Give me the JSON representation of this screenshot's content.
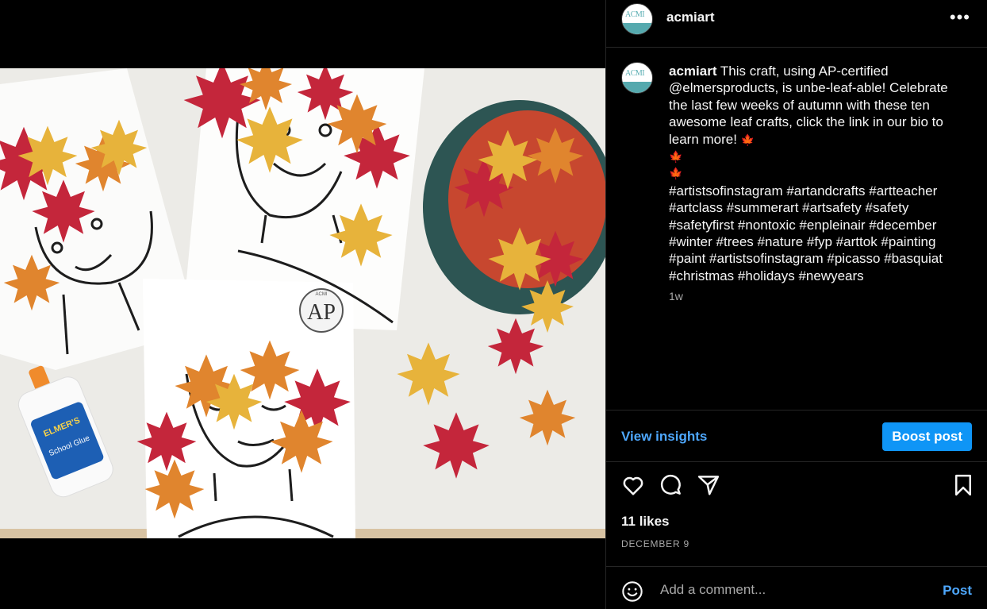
{
  "post": {
    "username": "acmiart",
    "avatar_text": "ACMI"
  },
  "caption": {
    "username": "acmiart",
    "lines": [
      "This craft, using AP-certified",
      "@elmersproducts, is unbe-leaf-able! Celebrate",
      "the last few weeks of autumn with these ten",
      "awesome leaf crafts, click the link in our bio to",
      "learn more!"
    ],
    "hashtag_lines": [
      "#artistsofinstagram #artandcrafts #artteacher",
      "#artclass #summerart #artsafety #safety",
      "#safetyfirst #nontoxic #enpleinair #december",
      "#winter #trees #nature #fyp #arttok #painting",
      "#paint #artistsofinstagram #picasso #basquiat",
      "#christmas #holidays #newyears"
    ],
    "emoji": "🍁",
    "time_ago": "1w"
  },
  "photo": {
    "seal_text": "AP",
    "seal_ring": "ACMI",
    "glue_brand": "ELMER'S",
    "glue_product": "School Glue"
  },
  "insights": {
    "view_label": "View insights",
    "boost_label": "Boost post"
  },
  "engagement": {
    "likes": "11 likes",
    "date": "DECEMBER 9"
  },
  "comment": {
    "placeholder": "Add a comment...",
    "post_label": "Post"
  },
  "icons": {
    "like": "heart-icon",
    "comment": "comment-bubble-icon",
    "share": "paper-plane-icon",
    "save": "bookmark-icon",
    "emoji": "smiley-icon",
    "more": "more-dots-icon"
  },
  "colors": {
    "background": "#000000",
    "link_blue": "#4ea8ff",
    "button_blue": "#0f95f6",
    "muted": "#a8a8a8",
    "divider": "#262626"
  }
}
